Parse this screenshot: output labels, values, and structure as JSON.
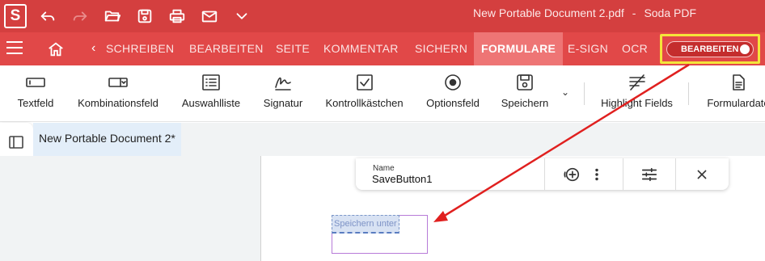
{
  "app": {
    "logo_letter": "S",
    "document_title": "New Portable Document 2.pdf",
    "separator": "-",
    "app_name": "Soda PDF"
  },
  "quick_access": [
    {
      "icon": "undo-icon",
      "disabled": false
    },
    {
      "icon": "redo-icon",
      "disabled": true
    },
    {
      "icon": "open-folder-icon",
      "disabled": false
    },
    {
      "icon": "save-icon",
      "disabled": false
    },
    {
      "icon": "print-icon",
      "disabled": false
    },
    {
      "icon": "mail-icon",
      "disabled": false
    },
    {
      "icon": "chevron-down-icon",
      "disabled": false
    }
  ],
  "menu": {
    "back_glyph": "‹",
    "tabs": [
      "SCHREIBEN",
      "BEARBEITEN",
      "SEITE",
      "KOMMENTAR",
      "SICHERN",
      "FORMULARE",
      "E-SIGN",
      "OCR"
    ],
    "active_tab": "FORMULARE",
    "edit_toggle_label": "BEARBEITEN"
  },
  "ribbon": {
    "items": [
      {
        "label": "Textfeld",
        "icon": "text-field-icon"
      },
      {
        "label": "Kombinationsfeld",
        "icon": "combo-box-icon"
      },
      {
        "label": "Auswahlliste",
        "icon": "list-box-icon"
      },
      {
        "label": "Signatur",
        "icon": "signature-icon"
      },
      {
        "label": "Kontrollkästchen",
        "icon": "checkbox-icon"
      },
      {
        "label": "Optionsfeld",
        "icon": "radio-button-icon"
      },
      {
        "label": "Speichern",
        "icon": "save-icon"
      },
      {
        "label": "Highlight Fields",
        "icon": "highlight-fields-icon"
      },
      {
        "label": "Formulardate",
        "icon": "form-data-icon"
      }
    ],
    "dropdown_glyph": "⌄"
  },
  "document_tab": {
    "label": "New Portable Document 2*"
  },
  "field_popup": {
    "name_label": "Name",
    "name_value": "SaveButton1"
  },
  "form_field": {
    "text": "Speichern unter"
  },
  "colors": {
    "titlebar": "#d43f3f",
    "menubar": "#e14848",
    "active_tab": "#ee7575",
    "highlight_box": "#f4e53a",
    "arrow": "#e0201f",
    "field_border": "#b77bd8"
  }
}
